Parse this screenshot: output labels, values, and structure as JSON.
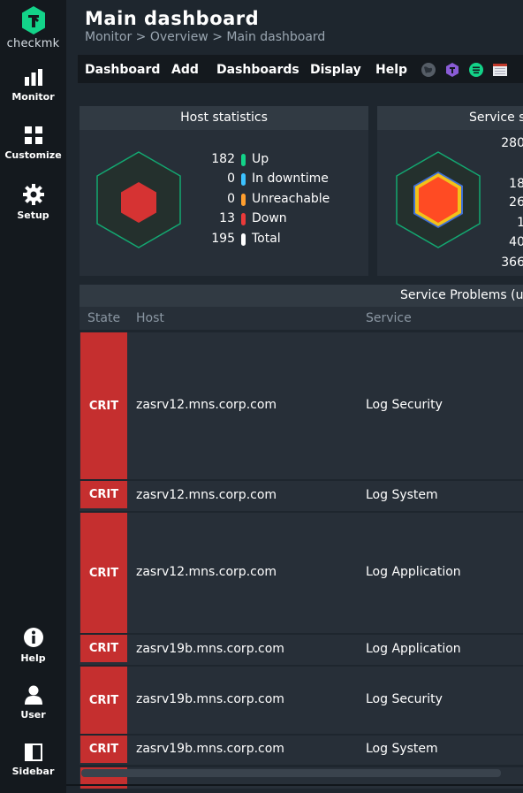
{
  "sidebar": {
    "logo_text": "checkmk",
    "items": [
      {
        "label": "Monitor",
        "icon": "monitor-icon"
      },
      {
        "label": "Customize",
        "icon": "customize-icon"
      },
      {
        "label": "Setup",
        "icon": "gear-icon"
      },
      {
        "label": "Help",
        "icon": "info-icon"
      },
      {
        "label": "User",
        "icon": "user-icon"
      },
      {
        "label": "Sidebar",
        "icon": "sidebar-icon"
      }
    ]
  },
  "header": {
    "title": "Main dashboard",
    "breadcrumb": "Monitor > Overview > Main dashboard"
  },
  "menu": {
    "items": [
      "Dashboard",
      "Add",
      "Dashboards",
      "Display",
      "Help"
    ]
  },
  "host_stats": {
    "title": "Host statistics",
    "rows": [
      {
        "value": "182",
        "label": "Up",
        "color": "#13d389"
      },
      {
        "value": "0",
        "label": "In downtime",
        "color": "#3cc2ff"
      },
      {
        "value": "0",
        "label": "Unreachable",
        "color": "#ff9f2f"
      },
      {
        "value": "13",
        "label": "Down",
        "color": "#ea3a3a"
      },
      {
        "value": "195",
        "label": "Total",
        "color": "#ffffff"
      }
    ]
  },
  "service_stats": {
    "title": "Service s",
    "values": [
      "280",
      "18",
      "26",
      "1",
      "40",
      "366"
    ]
  },
  "problems": {
    "title": "Service Problems (un",
    "columns": {
      "state": "State",
      "host": "Host",
      "service": "Service"
    },
    "rows": [
      {
        "state": "CRIT",
        "host": "zasrv12.mns.corp.com",
        "service": "Log Security"
      },
      {
        "state": "CRIT",
        "host": "zasrv12.mns.corp.com",
        "service": "Log System"
      },
      {
        "state": "CRIT",
        "host": "zasrv12.mns.corp.com",
        "service": "Log Application"
      },
      {
        "state": "CRIT",
        "host": "zasrv19b.mns.corp.com",
        "service": "Log Application"
      },
      {
        "state": "CRIT",
        "host": "zasrv19b.mns.corp.com",
        "service": "Log Security"
      },
      {
        "state": "CRIT",
        "host": "zasrv19b.mns.corp.com",
        "service": "Log System"
      }
    ]
  },
  "colors": {
    "crit": "#c52f2f",
    "accent": "#13d389"
  }
}
